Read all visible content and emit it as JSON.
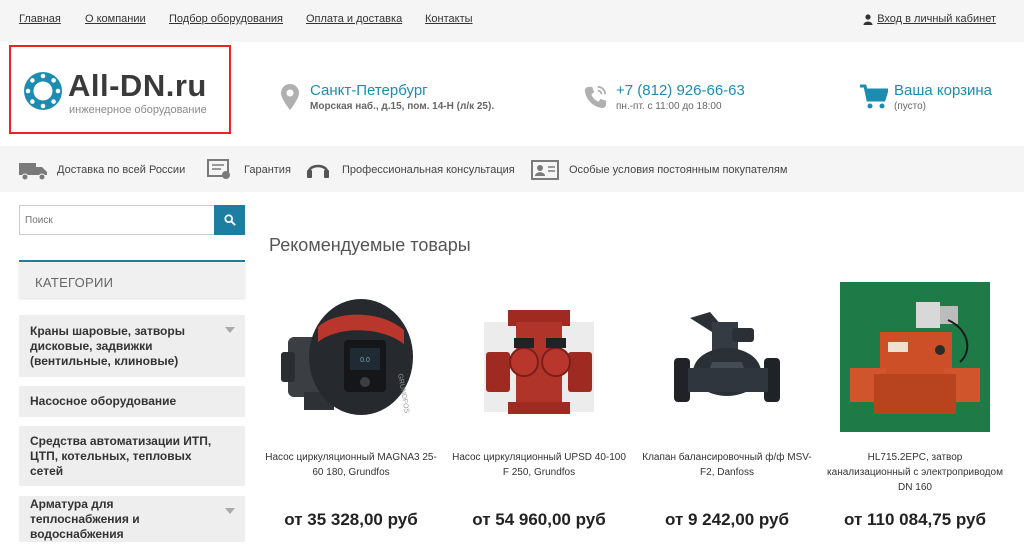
{
  "nav": {
    "items": [
      "Главная",
      "О компании",
      "Подбор оборудования",
      "Оплата и доставка",
      "Контакты"
    ],
    "login": "Вход в личный кабинет"
  },
  "logo": {
    "name": "All-DN.ru",
    "tagline": "инженерное оборудование"
  },
  "address": {
    "city": "Санкт-Петербург",
    "street": "Морская наб., д.15, пом. 14-Н (л/к 25)."
  },
  "phone": {
    "number": "+7 (812) 926-66-63",
    "hours": "пн.-пт. с 11:00 до 18:00"
  },
  "cart": {
    "label": "Ваша корзина",
    "status": "(пусто)"
  },
  "features": [
    "Доставка по всей России",
    "Гарантия",
    "Профессиональная консультация",
    "Особые условия постоянным покупателям"
  ],
  "search": {
    "placeholder": "Поиск"
  },
  "categories": {
    "title": "КАТЕГОРИИ",
    "items": [
      "Краны шаровые, затворы дисковые, задвижки (вентильные, клиновые)",
      "Насосное оборудование",
      "Средства автоматизации ИТП, ЦТП, котельных, тепловых сетей",
      "Арматура для теплоснабжения и водоснабжения"
    ]
  },
  "recommended": {
    "title": "Рекомендуемые товары",
    "products": [
      {
        "name": "Насос циркуляционный MAGNA3 25-60 180, Grundfos",
        "price": "от 35 328,00 руб"
      },
      {
        "name": "Насос циркуляционный UPSD 40-100 F 250, Grundfos",
        "price": "от 54 960,00 руб"
      },
      {
        "name": "Клапан балансировочный ф/ф MSV-F2, Danfoss",
        "price": "от 9 242,00 руб"
      },
      {
        "name": "HL715.2EPC, затвор канализационный с электроприводом DN 160",
        "price": "от 110 084,75 руб"
      }
    ]
  },
  "colors": {
    "accent": "#1c8cb0",
    "logo_frame": "#e22222",
    "pump_red": "#b8362c",
    "valve_dark": "#2b3036",
    "drain_orange": "#d0542c"
  }
}
